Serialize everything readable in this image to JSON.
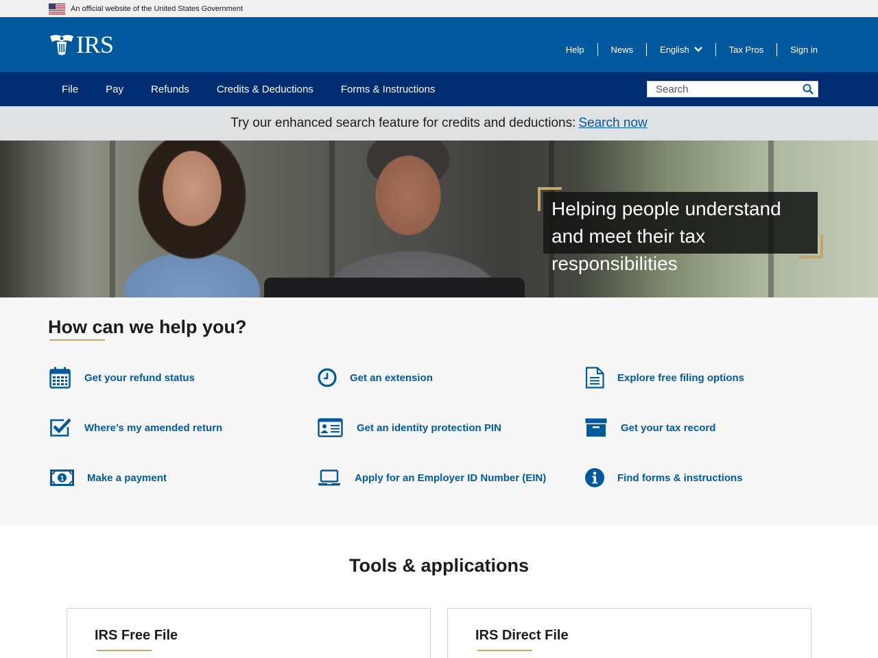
{
  "gov_banner": {
    "text": "An official website of the United States Government"
  },
  "header": {
    "logo_text": "IRS",
    "util_links": [
      "Help",
      "News",
      "English",
      "Tax Pros",
      "Sign in"
    ]
  },
  "nav": {
    "items": [
      "File",
      "Pay",
      "Refunds",
      "Credits & Deductions",
      "Forms & Instructions"
    ],
    "search_placeholder": "Search"
  },
  "alert": {
    "text": "Try our enhanced search feature for credits and deductions:",
    "link": "Search now"
  },
  "hero": {
    "text": "Helping people understand and meet their tax responsibilities"
  },
  "help": {
    "title": "How can we help you?",
    "links": [
      {
        "label": "Get your refund status",
        "icon": "calendar-icon"
      },
      {
        "label": "Get an extension",
        "icon": "clock-icon"
      },
      {
        "label": "Explore free filing options",
        "icon": "document-icon"
      },
      {
        "label": "Where’s my amended return",
        "icon": "checkmark-icon"
      },
      {
        "label": "Get an identity protection PIN",
        "icon": "id-card-icon"
      },
      {
        "label": "Get your tax record",
        "icon": "archive-box-icon"
      },
      {
        "label": "Make a payment",
        "icon": "money-icon"
      },
      {
        "label": "Apply for an Employer ID Number (EIN)",
        "icon": "laptop-icon"
      },
      {
        "label": "Find forms & instructions",
        "icon": "info-icon"
      }
    ]
  },
  "tools": {
    "title": "Tools & applications",
    "cards": [
      "IRS Free File",
      "IRS Direct File"
    ]
  },
  "colors": {
    "header_blue": "#00599c",
    "nav_navy": "#002d72",
    "accent_gold": "#c5a56a",
    "link_blue": "#00599c"
  }
}
